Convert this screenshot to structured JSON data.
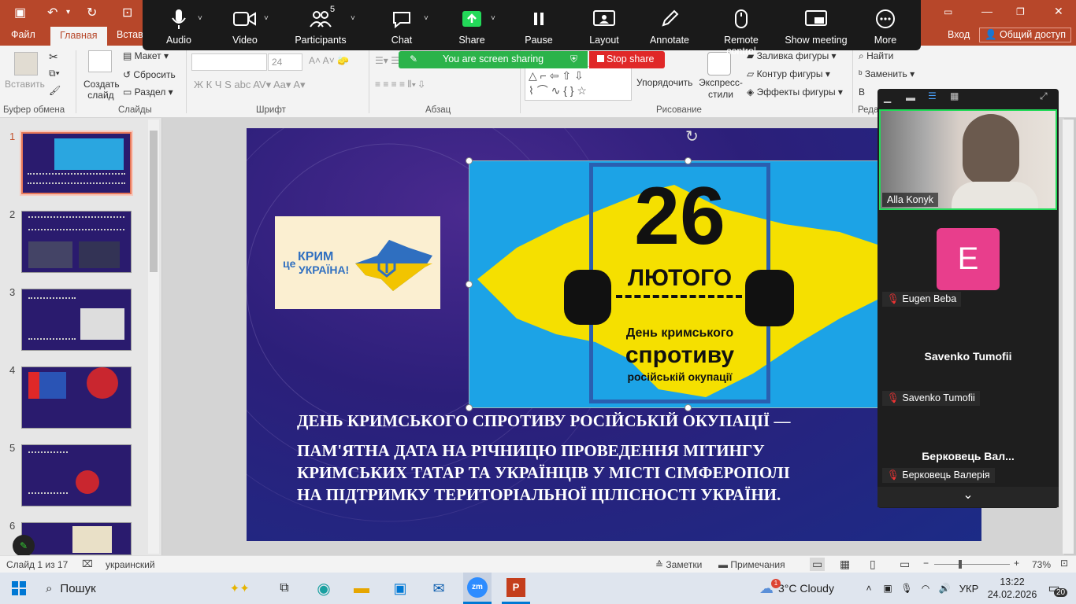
{
  "zoom": {
    "buttons": [
      {
        "label": "Audio",
        "icon": "microphone-icon"
      },
      {
        "label": "Video",
        "icon": "camera-icon"
      },
      {
        "label": "Participants",
        "icon": "participants-icon",
        "count": "5"
      },
      {
        "label": "Chat",
        "icon": "chat-icon"
      },
      {
        "label": "Share",
        "icon": "share-icon"
      },
      {
        "label": "Pause",
        "icon": "pause-icon"
      },
      {
        "label": "Layout",
        "icon": "layout-icon"
      },
      {
        "label": "Annotate",
        "icon": "pen-icon"
      },
      {
        "label": "Remote control",
        "icon": "mouse-icon"
      },
      {
        "label": "Show meeting",
        "icon": "show-meeting-icon"
      },
      {
        "label": "More",
        "icon": "more-icon"
      }
    ],
    "sharing": "You are screen sharing",
    "stop": "Stop share",
    "participants": [
      {
        "name": "Alla Konyk"
      },
      {
        "name": "Eugen Beba",
        "avatar": "E",
        "avatar_color": "#e83e8c"
      },
      {
        "name": "Savenko Tumofii",
        "title": "Savenko Tumofii"
      },
      {
        "name": "Берковець Валерія",
        "title": "Берковець  Вал..."
      }
    ]
  },
  "tabs": [
    "Файл",
    "Главная",
    "Вставк"
  ],
  "titlebar": {
    "login": "Вход",
    "share": "Общий доступ"
  },
  "ribbon": {
    "paste": "Вставить",
    "create_slide": "Создать слайд",
    "layout": "Макет",
    "reset": "Сбросить",
    "section": "Раздел",
    "font_size": "24",
    "arrange": "Упорядочить",
    "quick_styles": "Экспресс-стили",
    "fill": "Заливка фигуры",
    "outline": "Контур фигуры",
    "effects": "Эффекты фигуры",
    "find": "Найти",
    "replace": "Заменить",
    "select": "В",
    "groups": [
      "Буфер обмена",
      "Слайды",
      "Шрифт",
      "Абзац",
      "Рисование",
      "Реда"
    ]
  },
  "slide": {
    "logo_prefix": "це",
    "logo_line1": "КРИМ",
    "logo_line2": "УКРАЇНА!",
    "poster_number": "26",
    "poster_month": "ЛЮТОГО",
    "poster_line1": "День кримського",
    "poster_line2": "спротиву",
    "poster_line3": "російській окупації",
    "text_line1": "ДЕНЬ КРИМСЬКОГО СПРОТИВУ РОСІЙСЬКІЙ ОКУПАЦІЇ —",
    "text_line2": "ПАМ'ЯТНА ДАТА НА РІЧНИЦЮ ПРОВЕДЕННЯ МІТИНГУ",
    "text_line3": "КРИМСЬКИХ ТАТАР ТА УКРАЇНЦІВ У МІСТІ СІМФЕРОПОЛІ",
    "text_line4": "НА ПІДТРИМКУ ТЕРИТОРІАЛЬНОЇ ЦІЛІСНОСТІ УКРАЇНИ."
  },
  "thumbs": [
    "1",
    "2",
    "3",
    "4",
    "5",
    "6"
  ],
  "status": {
    "slide": "Слайд 1 из 17",
    "lang": "украинский",
    "notes": "Заметки",
    "comments": "Примечания",
    "zoom": "73%"
  },
  "taskbar": {
    "search": "Пошук",
    "weather": "3°C  Cloudy",
    "weather_badge": "1",
    "lang": "УКР",
    "time": "13:22",
    "date": "24.02.2026",
    "notif": "20"
  }
}
